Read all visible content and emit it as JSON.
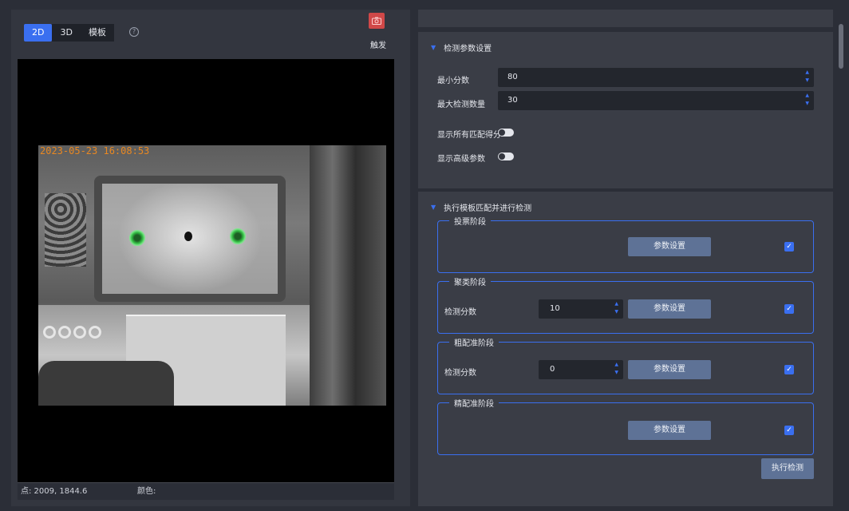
{
  "view_tabs": [
    {
      "label": "2D",
      "active": true
    },
    {
      "label": "3D",
      "active": false
    },
    {
      "label": "模板",
      "active": false
    }
  ],
  "help_icon_glyph": "?",
  "trigger": {
    "label": "触发",
    "icon": "camera-icon",
    "color": "#d04848"
  },
  "image": {
    "timestamp": "2023-05-23 16:08:53"
  },
  "status": {
    "point": "点: 2009, 1844.6",
    "color_label": "颜色:"
  },
  "detection_params": {
    "title": "检测参数设置",
    "min_score_label": "最小分数",
    "min_score_value": "80",
    "max_count_label": "最大检测数量",
    "max_count_value": "30",
    "show_all_scores_label": "显示所有匹配得分",
    "show_advanced_label": "显示高级参数"
  },
  "template_matching": {
    "title": "执行模板匹配并进行检测",
    "stages": [
      {
        "title": "投票阶段",
        "has_score": false,
        "score_label": "",
        "score_value": "",
        "button": "参数设置",
        "checked": true
      },
      {
        "title": "聚类阶段",
        "has_score": true,
        "score_label": "检测分数",
        "score_value": "10",
        "button": "参数设置",
        "checked": true
      },
      {
        "title": "粗配准阶段",
        "has_score": true,
        "score_label": "检测分数",
        "score_value": "0",
        "button": "参数设置",
        "checked": true
      },
      {
        "title": "精配准阶段",
        "has_score": false,
        "score_label": "",
        "score_value": "",
        "button": "参数设置",
        "checked": true
      }
    ],
    "execute_button": "执行检测"
  },
  "colors": {
    "accent": "#3a6ff0",
    "button": "#5e7296",
    "panel": "#3a3d46",
    "timestamp": "#e88822"
  }
}
